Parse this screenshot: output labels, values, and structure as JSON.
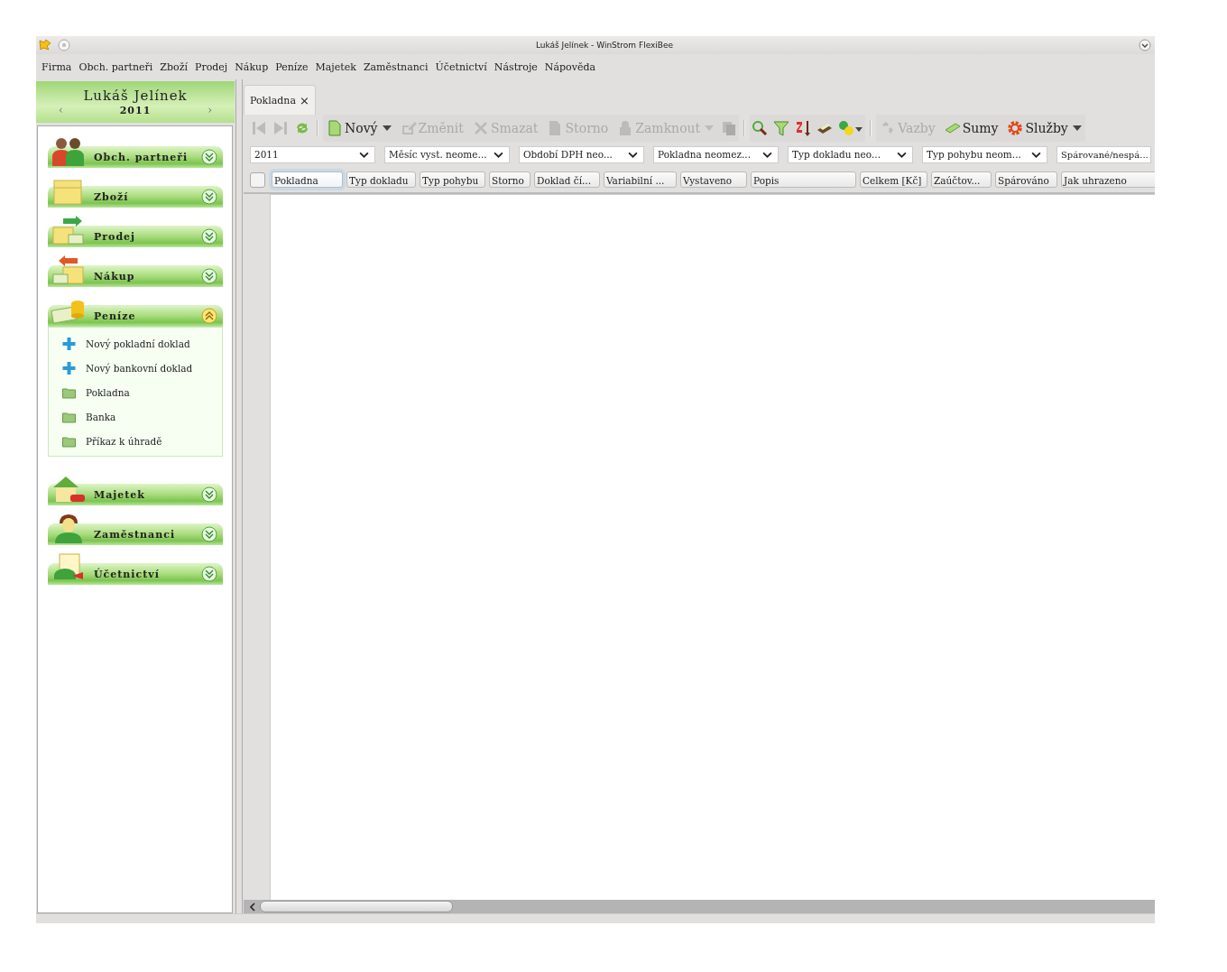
{
  "window": {
    "title": "Lukáš Jelínek - WinStrom FlexiBee"
  },
  "menu": [
    "Firma",
    "Obch. partneři",
    "Zboží",
    "Prodej",
    "Nákup",
    "Peníze",
    "Majetek",
    "Zaměstnanci",
    "Účetnictví",
    "Nástroje",
    "Nápověda"
  ],
  "sidebar": {
    "user": "Lukáš Jelínek",
    "year": "2011",
    "prev": "‹",
    "next": "›",
    "sections": [
      {
        "label": "Obch. partneři",
        "expanded": false
      },
      {
        "label": "Zboží",
        "expanded": false
      },
      {
        "label": "Prodej",
        "expanded": false
      },
      {
        "label": "Nákup",
        "expanded": false
      },
      {
        "label": "Peníze",
        "expanded": true,
        "items": [
          {
            "kind": "new",
            "label": "Nový pokladní doklad"
          },
          {
            "kind": "new",
            "label": "Nový bankovní doklad"
          },
          {
            "kind": "folder",
            "label": "Pokladna"
          },
          {
            "kind": "folder",
            "label": "Banka"
          },
          {
            "kind": "folder",
            "label": "Příkaz k úhradě"
          }
        ]
      },
      {
        "label": "Majetek",
        "expanded": false
      },
      {
        "label": "Zaměstnanci",
        "expanded": false
      },
      {
        "label": "Účetnictví",
        "expanded": false
      }
    ]
  },
  "tabs": [
    {
      "label": "Pokladna",
      "selected": true,
      "close": "×"
    }
  ],
  "toolbar": {
    "actions": [
      {
        "label": "Nový",
        "disabled": false,
        "dropdown": true
      },
      {
        "label": "Změnit",
        "disabled": true,
        "dropdown": false
      },
      {
        "label": "Smazat",
        "disabled": true,
        "dropdown": false
      },
      {
        "label": "Storno",
        "disabled": true,
        "dropdown": false
      },
      {
        "label": "Zamknout",
        "disabled": true,
        "dropdown": true
      }
    ],
    "links": [
      {
        "label": "Vazby",
        "disabled": true,
        "dropdown": false
      },
      {
        "label": "Sumy",
        "disabled": false,
        "dropdown": false
      },
      {
        "label": "Služby",
        "disabled": false,
        "dropdown": true
      }
    ]
  },
  "filters": [
    "2011",
    "Měsíc vyst. neome...",
    "Období DPH neo...",
    "Pokladna neomez...",
    "Typ dokladu neo...",
    "Typ pohybu neom...",
    "Spárované/nespá..."
  ],
  "select_all": {
    "checked": false
  },
  "columns": [
    {
      "label": "Pokladna",
      "selected": true
    },
    {
      "label": "Typ dokladu",
      "selected": false
    },
    {
      "label": "Typ pohybu",
      "selected": false
    },
    {
      "label": "Storno",
      "selected": false
    },
    {
      "label": "Doklad čí...",
      "selected": false
    },
    {
      "label": "Variabilní ...",
      "selected": false
    },
    {
      "label": "Vystaveno",
      "selected": false
    },
    {
      "label": "Popis",
      "selected": false
    },
    {
      "label": "Celkem [Kč]",
      "selected": false
    },
    {
      "label": "Zaúčtov...",
      "selected": false
    },
    {
      "label": "Spárováno",
      "selected": false
    },
    {
      "label": "Jak uhrazeno",
      "selected": false
    }
  ]
}
